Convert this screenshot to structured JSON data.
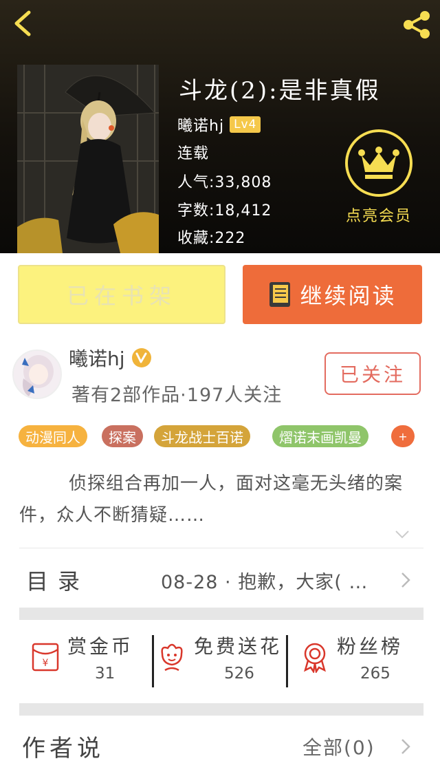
{
  "book": {
    "title": "斗龙(2):是非真假",
    "author": "曦诺hj",
    "level": "Lv4",
    "status": "连载",
    "popularity": "人气:33,808",
    "word_count": "字数:18,412",
    "favorites": "收藏:222"
  },
  "vip": {
    "label": "点亮会员"
  },
  "actions": {
    "shelf_label": "已在书架",
    "read_label": "继续阅读"
  },
  "author_card": {
    "name": "曦诺hj",
    "info": "著有2部作品·197人关注",
    "follow_label": "已关注"
  },
  "tags": [
    {
      "label": "动漫同人",
      "color": "#f6b23f"
    },
    {
      "label": "探案",
      "color": "#c9705f"
    },
    {
      "label": "斗龙战士百诺",
      "color": "#d4a43a"
    },
    {
      "label": "熠诺末画凯曼",
      "color": "#8fc56a"
    }
  ],
  "tag_more": "+",
  "description": "侦探组合再加一人，面对这毫无头绪的案件，众人不断猜疑……",
  "toc": {
    "label": "目录",
    "latest": "08-28 · 抱歉，大家( …"
  },
  "stats": [
    {
      "label": "赏金币",
      "value": "31",
      "icon": "red-envelope-icon"
    },
    {
      "label": "免费送花",
      "value": "526",
      "icon": "flower-icon"
    },
    {
      "label": "粉丝榜",
      "value": "265",
      "icon": "badge-icon"
    }
  ],
  "author_say": {
    "label": "作者说",
    "all": "全部(0)"
  },
  "colors": {
    "accent_orange": "#ee6c3a",
    "shelf_yellow": "#fcf27e",
    "vip_gold": "#f6dd52",
    "follow_red": "#e36b5f"
  }
}
